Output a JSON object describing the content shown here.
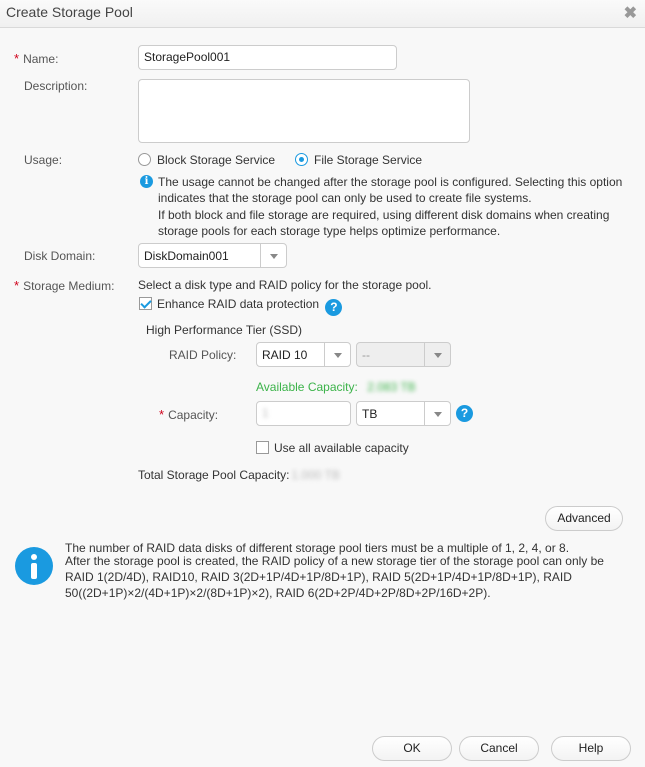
{
  "dialog": {
    "title": "Create Storage Pool",
    "close_icon": "close-icon"
  },
  "form": {
    "name": {
      "label": "Name:",
      "required": true,
      "value": "StoragePool001"
    },
    "description": {
      "label": "Description:",
      "value": ""
    },
    "usage": {
      "label": "Usage:",
      "options": [
        {
          "label": "Block Storage Service",
          "selected": false
        },
        {
          "label": "File Storage Service",
          "selected": true
        }
      ],
      "info_line1": "The usage cannot be changed after the storage pool is configured. Selecting this option indicates that the storage pool can only be used to create file systems.",
      "info_line2": "If both block and file storage are required, using different disk domains when creating storage pools for each storage type helps optimize performance."
    },
    "disk_domain": {
      "label": "Disk Domain:",
      "value": "DiskDomain001"
    },
    "storage_medium": {
      "label": "Storage Medium:",
      "required": true,
      "hint": "Select a disk type and RAID policy for the storage pool.",
      "enhance_raid": {
        "label": "Enhance RAID data protection",
        "checked": true
      },
      "tier": {
        "title": "High Performance Tier (SSD)",
        "raid_policy_label": "RAID Policy:",
        "raid_policy_value": "RAID 10",
        "raid_sub_value": "--",
        "available_capacity_label": "Available Capacity:",
        "available_capacity_value": "2.083 TB",
        "capacity_label": "Capacity:",
        "capacity_value": "1",
        "capacity_unit": "TB",
        "use_all_label": "Use all available capacity",
        "use_all_checked": false
      }
    },
    "total_capacity": {
      "label": "Total Storage Pool Capacity:",
      "value": "1.000 TB"
    }
  },
  "advanced_button": "Advanced",
  "notice": {
    "line1": "The number of RAID data disks of different storage pool tiers must be a multiple of 1, 2, 4, or 8.",
    "line2": "After the storage pool is created, the RAID policy of a new storage tier of the storage pool can only be RAID 1(2D/4D), RAID10, RAID 3(2D+1P/4D+1P/8D+1P), RAID 5(2D+1P/4D+1P/8D+1P), RAID 50((2D+1P)×2/(4D+1P)×2/(8D+1P)×2), RAID 6(2D+2P/4D+2P/8D+2P/16D+2P)."
  },
  "footer": {
    "ok": "OK",
    "cancel": "Cancel",
    "help": "Help"
  }
}
